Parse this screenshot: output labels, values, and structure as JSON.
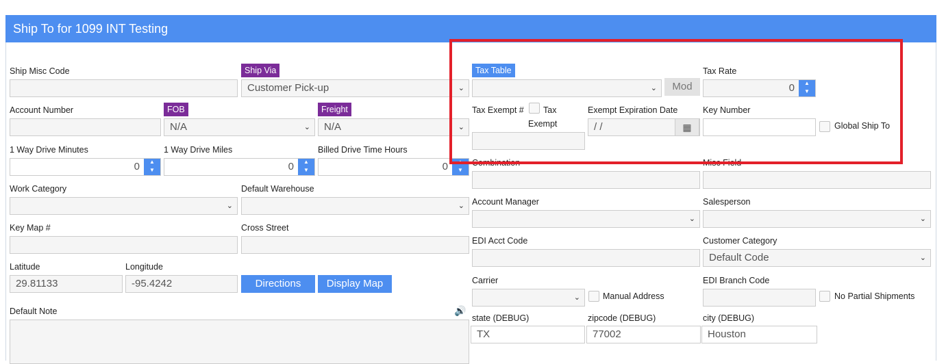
{
  "title": "Ship To for 1099 INT Testing",
  "left": {
    "ship_misc_code": {
      "label": "Ship Misc Code",
      "value": ""
    },
    "ship_via": {
      "label": "Ship Via",
      "value": "Customer Pick-up"
    },
    "account_number": {
      "label": "Account Number",
      "value": ""
    },
    "fob": {
      "label": "FOB",
      "value": "N/A"
    },
    "freight": {
      "label": "Freight",
      "value": "N/A"
    },
    "drive_minutes": {
      "label": "1 Way Drive Minutes",
      "value": "0"
    },
    "drive_miles": {
      "label": "1 Way Drive Miles",
      "value": "0"
    },
    "billed_hours": {
      "label": "Billed Drive Time Hours",
      "value": "0"
    },
    "work_category": {
      "label": "Work Category",
      "value": ""
    },
    "default_warehouse": {
      "label": "Default Warehouse",
      "value": ""
    },
    "key_map": {
      "label": "Key Map #",
      "value": ""
    },
    "cross_street": {
      "label": "Cross Street",
      "value": ""
    },
    "latitude": {
      "label": "Latitude",
      "value": "29.81133"
    },
    "longitude": {
      "label": "Longitude",
      "value": "-95.4242"
    },
    "directions_btn": "Directions",
    "display_map_btn": "Display Map",
    "default_note": {
      "label": "Default Note",
      "value": ""
    }
  },
  "right": {
    "tax_table": {
      "label": "Tax Table",
      "value": ""
    },
    "mod_btn": "Mod",
    "tax_rate": {
      "label": "Tax Rate",
      "value": "0"
    },
    "tax_exempt_num": {
      "label": "Tax Exempt #",
      "value": ""
    },
    "tax_exempt_cb_label_1": "Tax",
    "tax_exempt_cb_label_2": "Exempt",
    "exempt_expiration": {
      "label": "Exempt Expiration Date",
      "value": " /  /"
    },
    "key_number": {
      "label": "Key Number",
      "value": ""
    },
    "global_ship_to": "Global Ship To",
    "combination": {
      "label": "Combination",
      "value": ""
    },
    "misc_field": {
      "label": "Misc Field",
      "value": ""
    },
    "account_manager": {
      "label": "Account Manager",
      "value": ""
    },
    "salesperson": {
      "label": "Salesperson",
      "value": ""
    },
    "edi_acct_code": {
      "label": "EDI Acct Code",
      "value": ""
    },
    "customer_category": {
      "label": "Customer Category",
      "value": "Default Code"
    },
    "carrier": {
      "label": "Carrier",
      "value": ""
    },
    "manual_address": "Manual Address",
    "edi_branch_code": {
      "label": "EDI Branch Code",
      "value": ""
    },
    "no_partial_shipments": "No Partial Shipments",
    "state": {
      "label": "state (DEBUG)",
      "value": "TX"
    },
    "zipcode": {
      "label": "zipcode (DEBUG)",
      "value": "77002"
    },
    "city": {
      "label": "city (DEBUG)",
      "value": "Houston"
    }
  },
  "icons": {
    "chevron": "chevron-down-icon",
    "calendar": "calendar-icon",
    "speaker": "speaker-icon"
  },
  "colors": {
    "header": "#4d8ef0",
    "purple_tag": "#7b2c99",
    "highlight": "#e3202a"
  }
}
